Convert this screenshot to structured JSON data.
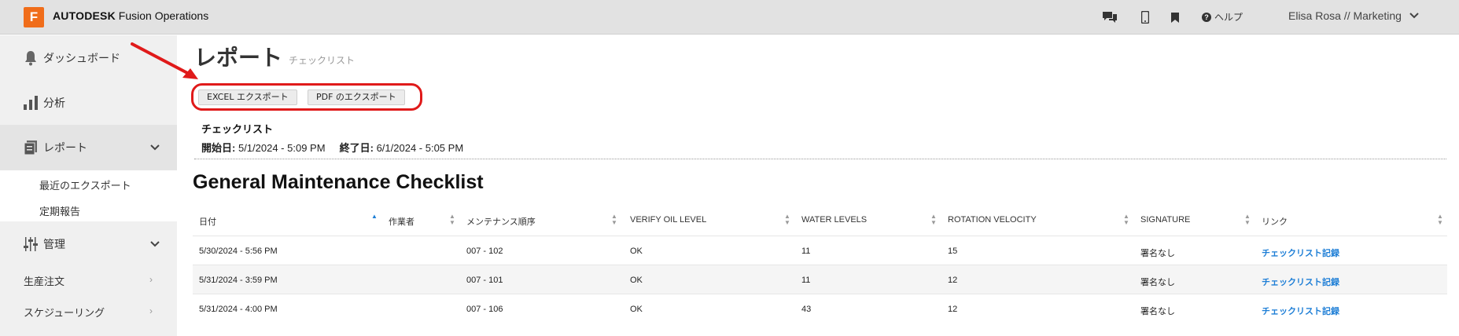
{
  "header": {
    "logo_letter": "F",
    "brand_bold": "AUTODESK",
    "brand_rest": "Fusion Operations",
    "help_label": "ヘルプ",
    "user_label": "Elisa Rosa // Marketing"
  },
  "sidebar": {
    "items": [
      {
        "label": "ダッシュボード"
      },
      {
        "label": "分析"
      },
      {
        "label": "レポート"
      },
      {
        "label": "管理"
      }
    ],
    "report_subitems": [
      {
        "label": "最近のエクスポート"
      },
      {
        "label": "定期報告"
      }
    ],
    "plain_items": [
      {
        "label": "生産注文"
      },
      {
        "label": "スケジューリング"
      }
    ]
  },
  "page": {
    "title": "レポート",
    "subtitle": "チェックリスト"
  },
  "toolbar": {
    "excel_label": "EXCEL エクスポート",
    "pdf_label": "PDF のエクスポート"
  },
  "info": {
    "title": "チェックリスト",
    "start_label": "開始日:",
    "start_value": "5/1/2024 - 5:09 PM",
    "end_label": "終了日:",
    "end_value": "6/1/2024 - 5:05 PM"
  },
  "checklist": {
    "title": "General Maintenance Checklist",
    "columns": [
      "日付",
      "作業者",
      "メンテナンス順序",
      "VERIFY OIL LEVEL",
      "WATER LEVELS",
      "ROTATION VELOCITY",
      "SIGNATURE",
      "リンク"
    ],
    "rows": [
      [
        "5/30/2024 - 5:56 PM",
        "",
        "007 - 102",
        "OK",
        "11",
        "15",
        "署名なし",
        "チェックリスト記録"
      ],
      [
        "5/31/2024 - 3:59 PM",
        "",
        "007 - 101",
        "OK",
        "11",
        "12",
        "署名なし",
        "チェックリスト記録"
      ],
      [
        "5/31/2024 - 4:00 PM",
        "",
        "007 - 106",
        "OK",
        "43",
        "12",
        "署名なし",
        "チェックリスト記録"
      ]
    ]
  },
  "colors": {
    "brand_orange": "#f06d1a",
    "highlight_red": "#e01a1a",
    "link_blue": "#1d7ed6",
    "sort_active": "#1d7ed6"
  },
  "icons": [
    "bell-icon",
    "bar-chart-icon",
    "report-icon",
    "sliders-icon",
    "chat-icon",
    "mobile-icon",
    "bookmark-icon",
    "help-icon",
    "chevron-down-icon",
    "chevron-right-icon",
    "sort-icon",
    "arrow-annotation"
  ]
}
